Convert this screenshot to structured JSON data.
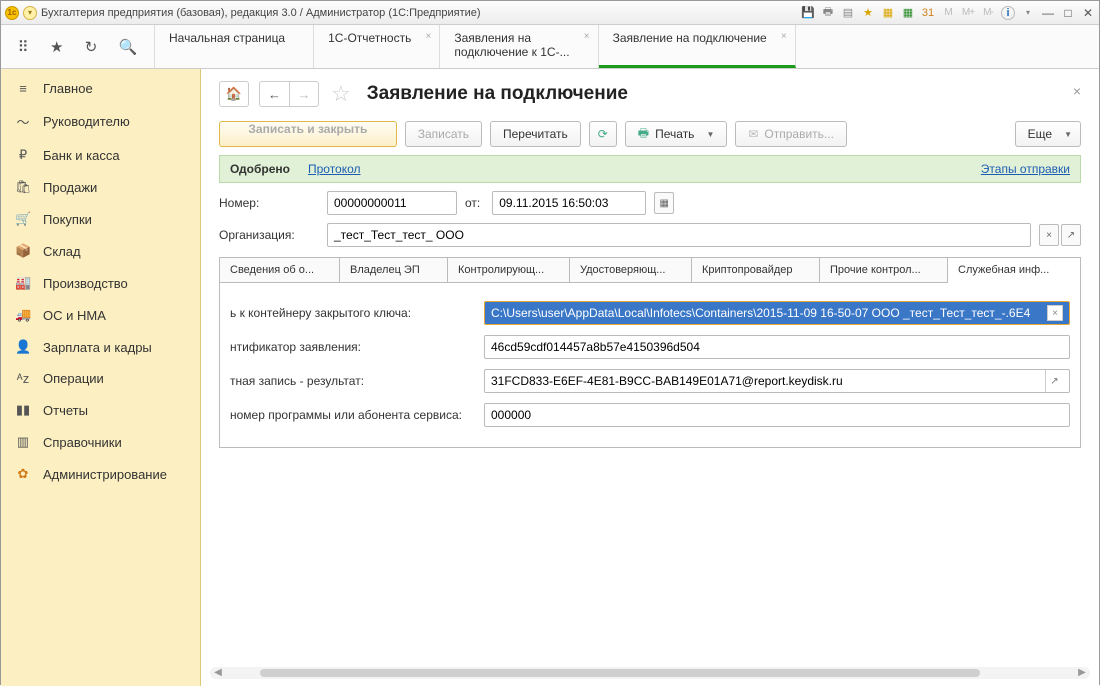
{
  "titlebar": {
    "title": "Бухгалтерия предприятия (базовая), редакция 3.0 / Администратор  (1С:Предприятие)",
    "mem": [
      "M",
      "M+",
      "M-"
    ]
  },
  "top_tabs": {
    "items": [
      {
        "label": "Начальная страница",
        "closable": false
      },
      {
        "label": "1С-Отчетность",
        "closable": true
      },
      {
        "label": "Заявления на подключение к 1С-...",
        "label1": "Заявления на",
        "label2": "подключение к 1С-...",
        "closable": true
      },
      {
        "label": "Заявление на подключение",
        "closable": true
      }
    ],
    "active_index": 3
  },
  "sidebar": {
    "items": [
      {
        "icon": "≡",
        "label": "Главное"
      },
      {
        "icon": "〜",
        "label": "Руководителю"
      },
      {
        "icon": "₽",
        "label": "Банк и касса"
      },
      {
        "icon": "🛍",
        "label": "Продажи"
      },
      {
        "icon": "🛒",
        "label": "Покупки"
      },
      {
        "icon": "📦",
        "label": "Склад"
      },
      {
        "icon": "🏭",
        "label": "Производство"
      },
      {
        "icon": "🚚",
        "label": "ОС и НМА"
      },
      {
        "icon": "👤",
        "label": "Зарплата и кадры"
      },
      {
        "icon": "ᴬᴢ",
        "label": "Операции"
      },
      {
        "icon": "▮▮",
        "label": "Отчеты"
      },
      {
        "icon": "▥",
        "label": "Справочники"
      },
      {
        "icon": "✿",
        "label": "Администрирование"
      }
    ]
  },
  "page": {
    "title": "Заявление на подключение",
    "buttons": {
      "save_close": "Записать и закрыть",
      "save": "Записать",
      "reread": "Перечитать",
      "print": "Печать",
      "send": "Отправить...",
      "more": "Еще"
    },
    "status": {
      "text": "Одобрено",
      "protocol": "Протокол",
      "stages": "Этапы отправки"
    },
    "labels": {
      "number": "Номер:",
      "from": "от:",
      "org": "Организация:"
    },
    "number": "00000000011",
    "date": "09.11.2015 16:50:03",
    "org": "_тест_Тест_тест_ ООО",
    "tabs2": [
      "Сведения об о...",
      "Владелец ЭП",
      "Контролирующ...",
      "Удостоверяющ...",
      "Криптопровайдер",
      "Прочие контрол...",
      "Служебная инф..."
    ],
    "tabs2_active": 6,
    "fields": {
      "container_lbl": "ь к контейнеру закрытого ключа:",
      "container_val": "C:\\Users\\user\\AppData\\Local\\Infotecs\\Containers\\2015-11-09 16-50-07 ООО _тест_Тест_тест_-.6E4",
      "appid_lbl": "нтификатор заявления:",
      "appid_val": "46cd59cdf014457a8b57e4150396d504",
      "result_lbl": "тная запись - результат:",
      "result_val": "31FCD833-E6EF-4E81-B9CC-BAB149E01A71@report.keydisk.ru",
      "regnum_lbl": "номер программы или абонента сервиса:",
      "regnum_val": "000000"
    }
  }
}
